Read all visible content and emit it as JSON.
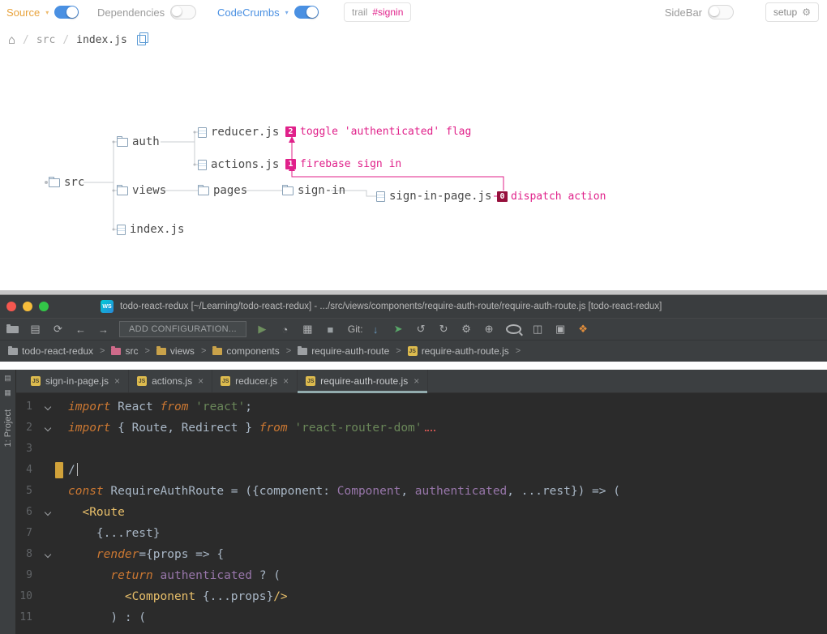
{
  "top": {
    "toolbar": {
      "source_label": "Source",
      "dependencies_label": "Dependencies",
      "codecrumbs_label": "CodeCrumbs",
      "chevron": "▾",
      "trail_label": "trail",
      "trail_value": "#signin",
      "sidebar_label": "SideBar",
      "setup_label": "setup"
    },
    "breadcrumb": {
      "separator": "/",
      "items": [
        "src",
        "index.js"
      ]
    },
    "tree": {
      "nodes": [
        {
          "label": "src",
          "type": "folder"
        },
        {
          "label": "auth",
          "type": "folder"
        },
        {
          "label": "views",
          "type": "folder"
        },
        {
          "label": "index.js",
          "type": "file"
        },
        {
          "label": "reducer.js",
          "type": "file"
        },
        {
          "label": "actions.js",
          "type": "file"
        },
        {
          "label": "pages",
          "type": "folder"
        },
        {
          "label": "sign-in",
          "type": "folder"
        },
        {
          "label": "sign-in-page.js",
          "type": "file"
        }
      ],
      "trail": [
        {
          "badge": "2",
          "text": "toggle 'authenticated' flag"
        },
        {
          "badge": "1",
          "text": "firebase sign in"
        },
        {
          "badge": "0",
          "text": "dispatch action"
        }
      ]
    },
    "colors": {
      "accent_blue": "#4a90e2",
      "trail_pink": "#e0218a",
      "source_orange": "#e8a33d"
    }
  },
  "ide": {
    "title": "todo-react-redux [~/Learning/todo-react-redux] - .../src/views/components/require-auth-route/require-auth-route.js [todo-react-redux]",
    "logo": "WS",
    "toolbar": {
      "add_configuration": "ADD CONFIGURATION...",
      "git_label": "Git:",
      "icons_left": [
        {
          "name": "open-folder-icon",
          "cls": "mini-folder mf-gray"
        },
        {
          "name": "save-icon",
          "glyph": "▤"
        },
        {
          "name": "sync-icon",
          "glyph": "⟳"
        },
        {
          "name": "back-icon",
          "glyph": "←"
        },
        {
          "name": "forward-icon",
          "glyph": "→"
        }
      ],
      "icons_run": [
        {
          "name": "run-icon",
          "glyph": "▶",
          "color": "#6e8f5e"
        },
        {
          "name": "profiler-icon",
          "glyph": "◔"
        },
        {
          "name": "coverage-icon",
          "glyph": "▦"
        },
        {
          "name": "stop-icon",
          "glyph": "■",
          "color": "#9aa0a3"
        }
      ],
      "icons_vcs": [
        {
          "name": "update-project-icon",
          "glyph": "↓",
          "color": "#6897bb"
        },
        {
          "name": "push-icon",
          "glyph": "➤",
          "color": "#59a869"
        },
        {
          "name": "history-back-icon",
          "glyph": "↺"
        },
        {
          "name": "history-forward-icon",
          "glyph": "↻"
        },
        {
          "name": "settings-icon",
          "glyph": "⚙"
        },
        {
          "name": "plugins-icon",
          "glyph": "⊕"
        },
        {
          "name": "search-everywhere-icon",
          "cls": "icon-search"
        },
        {
          "name": "layout-icon",
          "glyph": "◫"
        },
        {
          "name": "windows-icon",
          "glyph": "▣"
        },
        {
          "name": "extensions-icon",
          "glyph": "❖",
          "color": "#e08d3c"
        }
      ]
    },
    "crumb_separator": ">",
    "breadcrumbs": [
      {
        "label": "todo-react-redux",
        "icon": "mf-gray",
        "icon_name": "folder-icon"
      },
      {
        "label": "src",
        "icon": "mf-pink",
        "icon_name": "source-root-icon"
      },
      {
        "label": "views",
        "icon": "mf-yellow",
        "icon_name": "folder-icon"
      },
      {
        "label": "components",
        "icon": "mf-yellow",
        "icon_name": "folder-icon"
      },
      {
        "label": "require-auth-route",
        "icon": "mf-gray",
        "icon_name": "folder-icon"
      },
      {
        "label": "require-auth-route.js",
        "icon": "js",
        "icon_name": "js-file-icon"
      }
    ],
    "js_badge": "JS",
    "tab_close": "×",
    "project_tab": "1: Project",
    "tabs": [
      {
        "label": "sign-in-page.js",
        "active": false
      },
      {
        "label": "actions.js",
        "active": false
      },
      {
        "label": "reducer.js",
        "active": false
      },
      {
        "label": "require-auth-route.js",
        "active": true
      }
    ],
    "code": {
      "lines": [
        {
          "n": 1,
          "fold": true,
          "tokens": [
            [
              "k",
              "import"
            ],
            [
              "d",
              " React "
            ],
            [
              "k",
              "from"
            ],
            [
              "d",
              " "
            ],
            [
              "s",
              "'react'"
            ],
            [
              "d",
              ";"
            ]
          ]
        },
        {
          "n": 2,
          "fold": true,
          "err": true,
          "tokens": [
            [
              "k",
              "import"
            ],
            [
              "d",
              " { Route, Redirect } "
            ],
            [
              "k",
              "from"
            ],
            [
              "d",
              " "
            ],
            [
              "s",
              "'react-router-dom'"
            ]
          ]
        },
        {
          "n": 3,
          "tokens": []
        },
        {
          "n": 4,
          "marker": true,
          "caret": true,
          "tokens": [
            [
              "d",
              "/"
            ]
          ]
        },
        {
          "n": 5,
          "tokens": [
            [
              "k",
              "const"
            ],
            [
              "d",
              " RequireAuthRoute = ({component: "
            ],
            [
              "p",
              "Component"
            ],
            [
              "d",
              ", "
            ],
            [
              "p",
              "authenticated"
            ],
            [
              "d",
              ", ...rest}) => ("
            ]
          ]
        },
        {
          "n": 6,
          "fold": true,
          "tokens": [
            [
              "d",
              "  "
            ],
            [
              "t",
              "<Route"
            ]
          ]
        },
        {
          "n": 7,
          "tokens": [
            [
              "d",
              "    {...rest}"
            ]
          ]
        },
        {
          "n": 8,
          "fold": true,
          "tokens": [
            [
              "d",
              "    "
            ],
            [
              "k",
              "render"
            ],
            [
              "d",
              "={props => {"
            ]
          ]
        },
        {
          "n": 9,
          "tokens": [
            [
              "d",
              "      "
            ],
            [
              "k",
              "return"
            ],
            [
              "d",
              " "
            ],
            [
              "p",
              "authenticated"
            ],
            [
              "d",
              " ? ("
            ]
          ]
        },
        {
          "n": 10,
          "tokens": [
            [
              "d",
              "        "
            ],
            [
              "t",
              "<Component"
            ],
            [
              "d",
              " {...props}"
            ],
            [
              "t",
              "/>"
            ]
          ]
        },
        {
          "n": 11,
          "tokens": [
            [
              "d",
              "      ) : ("
            ]
          ]
        }
      ]
    }
  }
}
